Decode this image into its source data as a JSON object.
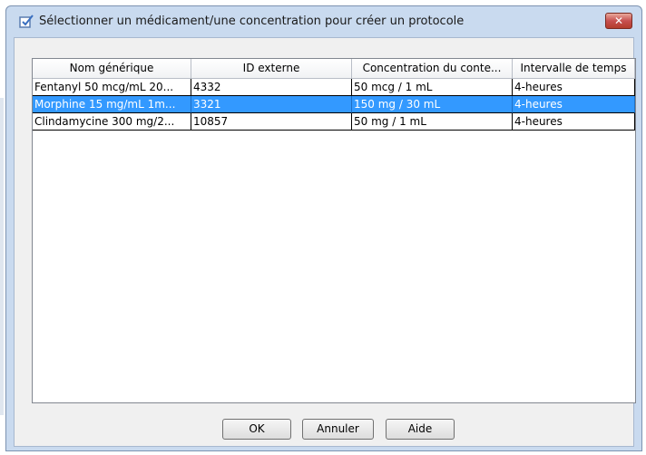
{
  "window": {
    "title": "Sélectionner un médicament/une concentration pour créer un protocole",
    "close_label": "✕"
  },
  "table": {
    "columns": [
      "Nom générique",
      "ID externe",
      "Concentration du conte...",
      "Intervalle de temps"
    ],
    "rows": [
      {
        "name": "Fentanyl 50 mcg/mL 20...",
        "id": "4332",
        "concentration": "50 mcg / 1 mL",
        "interval": "4-heures"
      },
      {
        "name": "Morphine 15 mg/mL  1m...",
        "id": "3321",
        "concentration": "150 mg / 30 mL",
        "interval": "4-heures"
      },
      {
        "name": "Clindamycine 300 mg/2...",
        "id": "10857",
        "concentration": "50 mg / 1 mL",
        "interval": "4-heures"
      }
    ],
    "selected_row_index": 1,
    "selection_color": "#3399ff"
  },
  "buttons": {
    "ok": "OK",
    "cancel": "Annuler",
    "help": "Aide"
  }
}
